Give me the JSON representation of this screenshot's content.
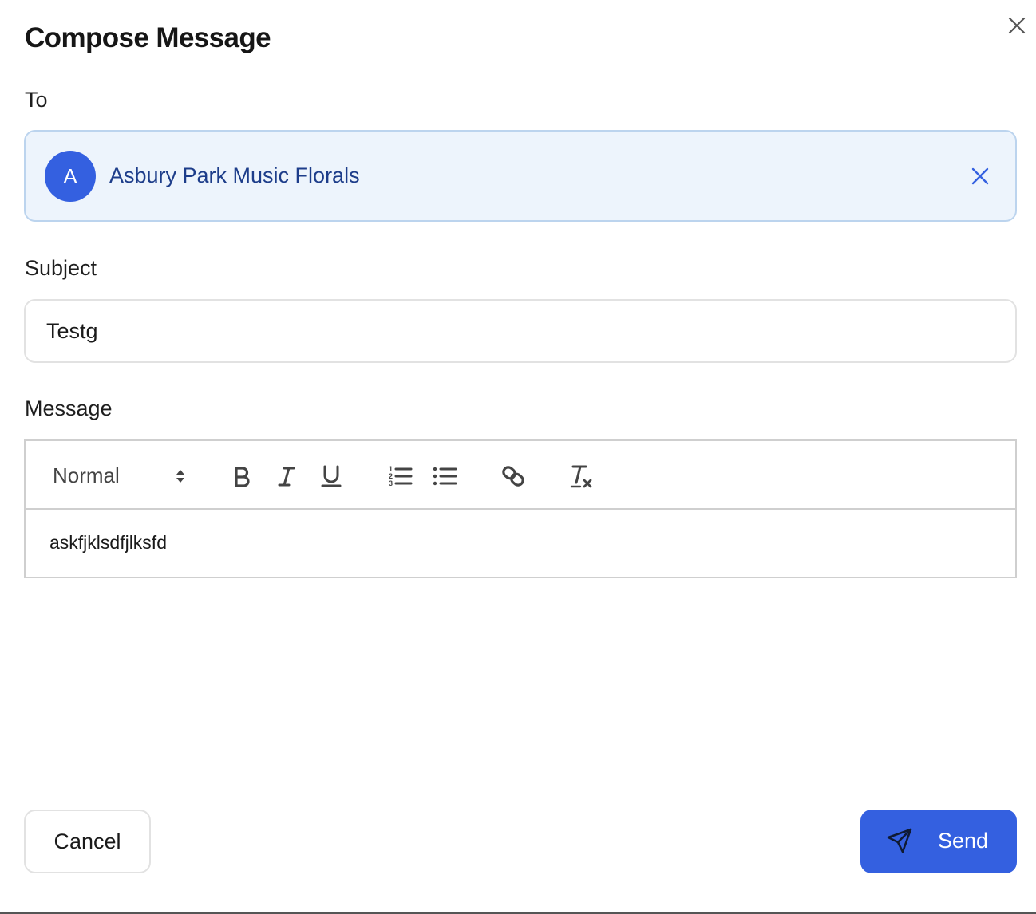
{
  "dialog": {
    "title": "Compose Message"
  },
  "to": {
    "label": "To",
    "recipient": {
      "initial": "A",
      "name": "Asbury Park Music Florals"
    }
  },
  "subject": {
    "label": "Subject",
    "value": "Testg"
  },
  "message": {
    "label": "Message",
    "toolbar": {
      "format_value": "Normal",
      "tools": [
        "bold",
        "italic",
        "underline",
        "ordered-list",
        "bullet-list",
        "link",
        "clear-format"
      ]
    },
    "body": "askfjklsdfjlksfd"
  },
  "actions": {
    "cancel_label": "Cancel",
    "send_label": "Send"
  },
  "colors": {
    "accent": "#3460e0",
    "recipient_bg": "#edf4fc",
    "recipient_text": "#1d3d8a"
  },
  "icons": [
    "close-icon",
    "remove-recipient-icon",
    "select-arrows-icon",
    "bold-icon",
    "italic-icon",
    "underline-icon",
    "ordered-list-icon",
    "bullet-list-icon",
    "link-icon",
    "clear-format-icon",
    "send-icon"
  ]
}
